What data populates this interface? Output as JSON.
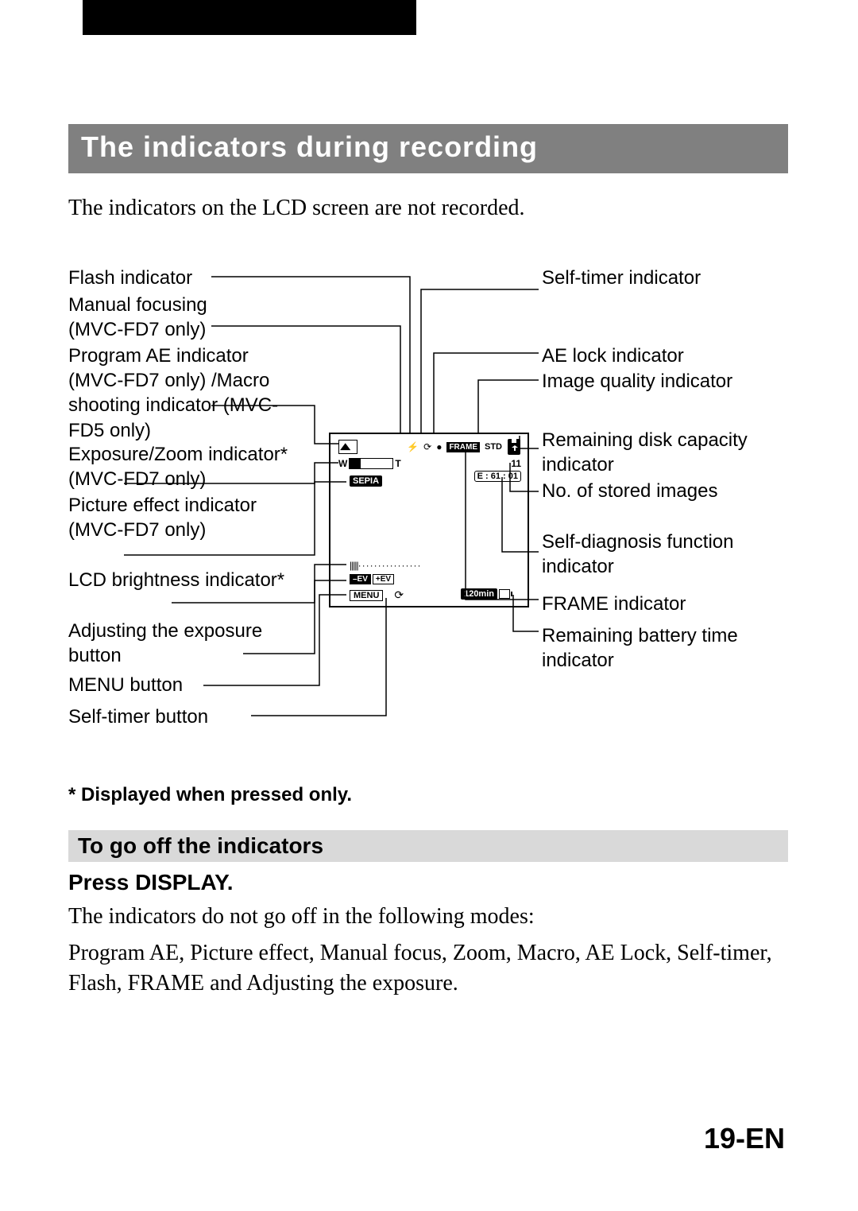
{
  "heading": "The indicators during recording",
  "intro": "The indicators on the LCD screen are not recorded.",
  "labels": {
    "left": [
      "Flash indicator",
      "Manual focusing\n(MVC-FD7 only)",
      "Program AE indicator (MVC-FD7 only) /Macro shooting indicator (MVC-FD5 only)",
      "Exposure/Zoom indicator*   (MVC-FD7 only)",
      "Picture effect indicator   (MVC-FD7 only)",
      "LCD brightness indicator*",
      "Adjusting the exposure button",
      "MENU button",
      "Self-timer button"
    ],
    "right": [
      "Self-timer indicator",
      "AE lock indicator",
      "Image quality indicator",
      "Remaining disk capacity indicator",
      "No. of stored images",
      "Self-diagnosis function indicator",
      "FRAME indicator",
      "Remaining battery time indicator"
    ],
    "note": "* Displayed when pressed only."
  },
  "lcd": {
    "flash_glyph": "⚡",
    "timer_glyph": "⟳",
    "ae_lock_glyph": "●",
    "frame": "FRAME",
    "std": "STD",
    "zoom_w": "W",
    "zoom_t": "T",
    "count": "11",
    "diag": "E : 61 : 01",
    "sepia": "SEPIA",
    "ev_neg": "–EV",
    "ev_pos": "+EV",
    "menu": "MENU",
    "batt": "120min",
    "bright_bars": "|||||",
    "bright_dots": "················"
  },
  "sub_heading": "To go off the indicators",
  "press": "Press DISPLAY.",
  "off_text_1": "The indicators do not go off in the following modes:",
  "off_text_2": "Program AE, Picture effect, Manual focus, Zoom, Macro, AE Lock, Self-timer, Flash, FRAME and Adjusting the exposure.",
  "page_number": "19-EN"
}
